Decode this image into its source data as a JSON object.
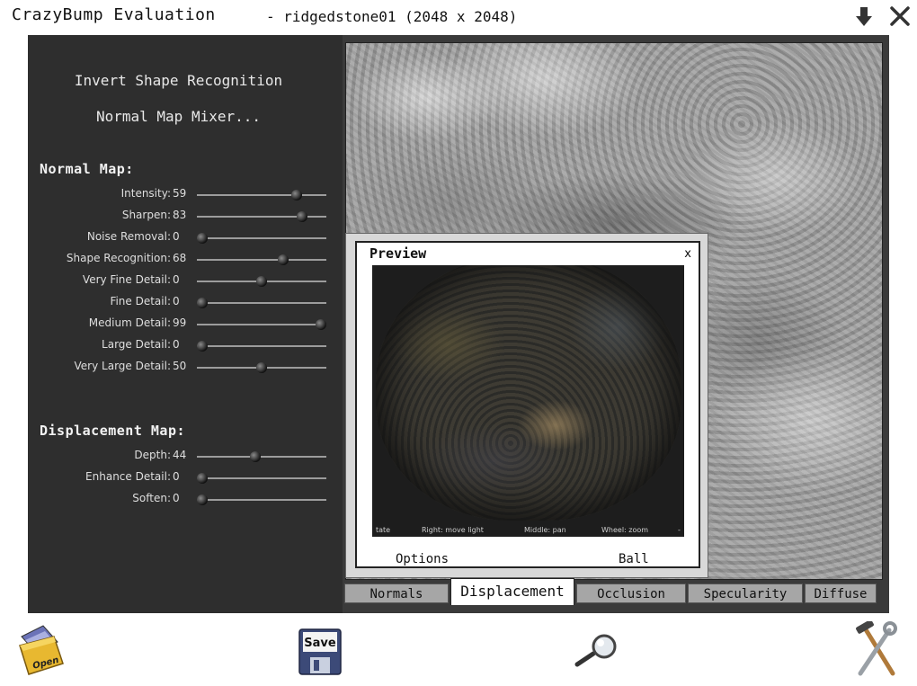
{
  "titlebar": {
    "app_title": "CrazyBump Evaluation",
    "file_title": "- ridgedstone01 (2048 x 2048)"
  },
  "left_panel": {
    "menu": [
      "Invert Shape Recognition",
      "Normal Map Mixer..."
    ],
    "normal_map": {
      "title": "Normal Map:",
      "params": [
        {
          "label": "Intensity:",
          "value": "59",
          "level": 0.77
        },
        {
          "label": "Sharpen:",
          "value": "83",
          "level": 0.81
        },
        {
          "label": "Noise Removal:",
          "value": "0",
          "level": 0.04
        },
        {
          "label": "Shape Recognition:",
          "value": "68",
          "level": 0.67
        },
        {
          "label": "Very Fine Detail:",
          "value": "0",
          "level": 0.5
        },
        {
          "label": "Fine Detail:",
          "value": "0",
          "level": 0.04
        },
        {
          "label": "Medium Detail:",
          "value": "99",
          "level": 0.96
        },
        {
          "label": "Large Detail:",
          "value": "0",
          "level": 0.04
        },
        {
          "label": "Very Large Detail:",
          "value": "50",
          "level": 0.5
        }
      ]
    },
    "displacement_map": {
      "title": "Displacement Map:",
      "params": [
        {
          "label": "Depth:",
          "value": "44",
          "level": 0.45
        },
        {
          "label": "Enhance Detail:",
          "value": "0",
          "level": 0.04
        },
        {
          "label": "Soften:",
          "value": "0",
          "level": 0.04
        }
      ]
    }
  },
  "tabs": [
    "Normals",
    "Displacement",
    "Occlusion",
    "Specularity",
    "Diffuse"
  ],
  "active_tab": "Displacement",
  "preview": {
    "title": "Preview",
    "close": "x",
    "help": [
      "tate",
      "Right: move light",
      "Middle: pan",
      "Wheel: zoom",
      "-"
    ],
    "options_label": "Options",
    "shape_label": "Ball"
  },
  "toolbar": {
    "open_label": "Open",
    "save_label": "Save"
  }
}
